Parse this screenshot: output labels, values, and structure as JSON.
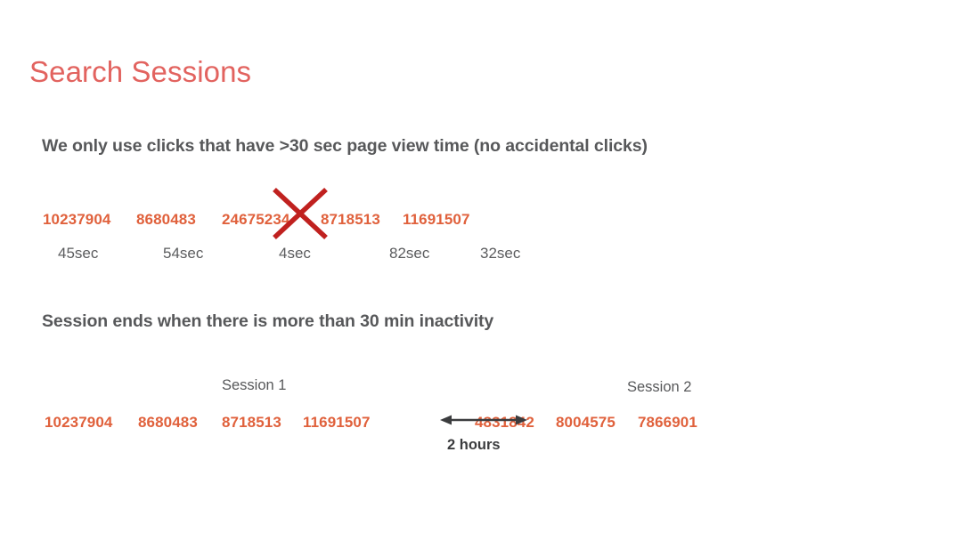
{
  "slide": {
    "title": "Search Sessions",
    "background_color": "#ffffff",
    "title_color": "#e2635f",
    "id_color": "#e0613c",
    "text_color": "#57585a",
    "mark_color": "#c0211f",
    "arrow_color": "#3b3c3e"
  },
  "rule_one": {
    "heading": "We only use clicks that have >30 sec page view time (no accidental clicks)",
    "clicks": [
      {
        "id": "10237904",
        "duration": "45sec",
        "excluded": "false"
      },
      {
        "id": "8680483",
        "duration": "54sec",
        "excluded": "false"
      },
      {
        "id": "24675234",
        "duration": "4sec",
        "excluded": "true"
      },
      {
        "id": "8718513",
        "duration": "82sec",
        "excluded": "false"
      },
      {
        "id": "11691507",
        "duration": "32sec",
        "excluded": "false"
      }
    ],
    "exclusion_mark": "x-mark"
  },
  "rule_two": {
    "heading": "Session ends when there is more than 30 min inactivity",
    "sessions": [
      {
        "label": "Session 1",
        "ids": [
          "10237904",
          "8680483",
          "8718513",
          "11691507"
        ]
      },
      {
        "label": "Session 2",
        "ids": [
          "4831842",
          "8004575",
          "7866901"
        ]
      }
    ],
    "gap": {
      "label": "2 hours",
      "arrow": "double-headed-arrow"
    }
  }
}
